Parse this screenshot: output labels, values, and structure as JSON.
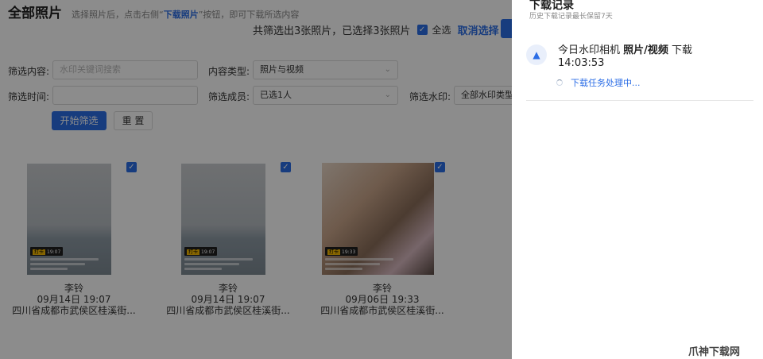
{
  "header": {
    "title": "全部照片",
    "hint_before": "选择照片后，点击右侧“",
    "hint_link": "下载照片",
    "hint_after": "”按钮，即可下载所选内容"
  },
  "selection": {
    "summary": "共筛选出3张照片，已选择3张照片",
    "select_all": "全选",
    "cancel": "取消选择"
  },
  "filters": {
    "content_label": "筛选内容:",
    "content_placeholder": "水印关键词搜索",
    "type_label": "内容类型:",
    "type_value": "照片与视频",
    "time_label": "筛选时间:",
    "member_label": "筛选成员:",
    "member_value": "已选1人",
    "watermark_label": "筛选水印:",
    "watermark_value": "全部水印类型",
    "start_button": "开始筛选",
    "reset_button": "重 置"
  },
  "photos": [
    {
      "name": "李铃",
      "date": "09月14日 19:07",
      "address": "四川省成都市武侯区桂溪街...",
      "stamp": "19:07"
    },
    {
      "name": "李铃",
      "date": "09月14日 19:07",
      "address": "四川省成都市武侯区桂溪街...",
      "stamp": "19:07"
    },
    {
      "name": "李铃",
      "date": "09月06日 19:33",
      "address": "四川省成都市武侯区桂溪街...",
      "stamp": "19:33"
    }
  ],
  "drawer": {
    "title": "下载记录",
    "subtitle": "历史下载记录最长保留7天",
    "item": {
      "app": "今日水印相机",
      "kind": "照片/视频",
      "action": "下载",
      "time": "14:03:53",
      "status": "下载任务处理中..."
    }
  },
  "site_logo": "爪神下载网",
  "icons": {
    "checkbox": "check-icon",
    "app": "mountain-icon",
    "loading": "spinner-icon",
    "select_arrow": "chevron-down-icon"
  },
  "colors": {
    "accent": "#2b6de6",
    "overlay": "rgba(0,0,0,0.45)"
  }
}
